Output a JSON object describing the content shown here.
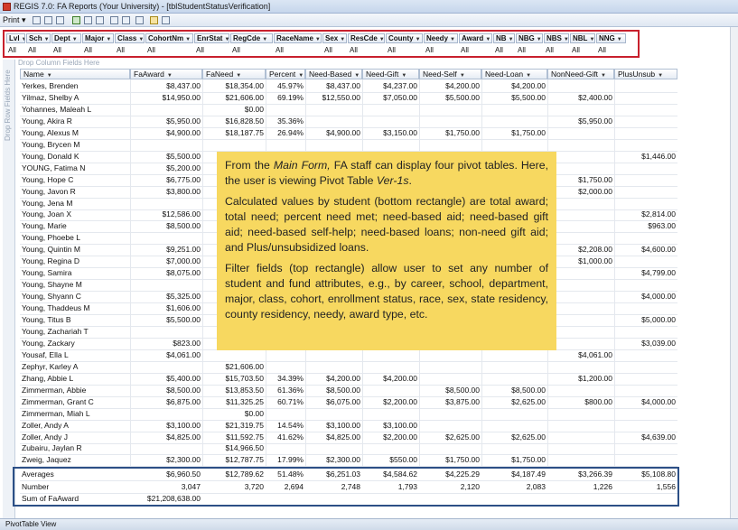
{
  "window": {
    "title": "REGIS 7.0: FA Reports (Your University) - [tblStudentStatusVerification]"
  },
  "toolbar": {
    "print_label": "Print"
  },
  "filters": [
    {
      "label": "Lvl",
      "value": "All"
    },
    {
      "label": "Sch",
      "value": "All"
    },
    {
      "label": "Dept",
      "value": "All"
    },
    {
      "label": "Major",
      "value": "All"
    },
    {
      "label": "Class",
      "value": "All"
    },
    {
      "label": "CohortNm",
      "value": "All"
    },
    {
      "label": "EnrStat",
      "value": "All"
    },
    {
      "label": "RegCde",
      "value": "All"
    },
    {
      "label": "RaceName",
      "value": "All"
    },
    {
      "label": "Sex",
      "value": "All"
    },
    {
      "label": "ResCde",
      "value": "All"
    },
    {
      "label": "County",
      "value": "All"
    },
    {
      "label": "Needy",
      "value": "All"
    },
    {
      "label": "Award",
      "value": "All"
    },
    {
      "label": "NB",
      "value": "All"
    },
    {
      "label": "NBG",
      "value": "All"
    },
    {
      "label": "NBS",
      "value": "All"
    },
    {
      "label": "NBL",
      "value": "All"
    },
    {
      "label": "NNG",
      "value": "All"
    }
  ],
  "drop_column_text": "Drop Column Fields Here",
  "drop_row_text": "Drop Row Fields Here",
  "columns": [
    "Name",
    "FaAward",
    "FaNeed",
    "Percent",
    "Need-Based",
    "Need-Gift",
    "Need-Self",
    "Need-Loan",
    "NonNeed-Gift",
    "PlusUnsub"
  ],
  "rows": [
    [
      "Yerkes, Brenden",
      "$8,437.00",
      "$18,354.00",
      "45.97%",
      "$8,437.00",
      "$4,237.00",
      "$4,200.00",
      "$4,200.00",
      "",
      ""
    ],
    [
      "Yilmaz, Shelby A",
      "$14,950.00",
      "$21,606.00",
      "69.19%",
      "$12,550.00",
      "$7,050.00",
      "$5,500.00",
      "$5,500.00",
      "$2,400.00",
      ""
    ],
    [
      "Yohannes, Maleah L",
      "",
      "$0.00",
      "",
      "",
      "",
      "",
      "",
      "",
      ""
    ],
    [
      "Young, Akira R",
      "$5,950.00",
      "$16,828.50",
      "35.36%",
      "",
      "",
      "",
      "",
      "$5,950.00",
      ""
    ],
    [
      "Young, Alexus M",
      "$4,900.00",
      "$18,187.75",
      "26.94%",
      "$4,900.00",
      "$3,150.00",
      "$1,750.00",
      "$1,750.00",
      "",
      ""
    ],
    [
      "Young, Brycen M",
      "",
      "",
      "",
      "",
      "",
      "",
      "",
      "",
      ""
    ],
    [
      "Young, Donald K",
      "$5,500.00",
      "",
      "",
      "",
      "",
      "",
      "",
      "",
      "$1,446.00"
    ],
    [
      "YOUNG, Fatima N",
      "$5,200.00",
      "",
      "",
      "",
      "",
      "",
      "",
      "",
      ""
    ],
    [
      "Young, Hope C",
      "$6,775.00",
      "",
      "",
      "",
      "",
      "",
      "",
      "$1,750.00",
      ""
    ],
    [
      "Young, Javon R",
      "$3,800.00",
      "",
      "",
      "",
      "",
      "",
      "",
      "$2,000.00",
      ""
    ],
    [
      "Young, Jena M",
      "",
      "",
      "",
      "",
      "",
      "",
      "",
      "",
      ""
    ],
    [
      "Young, Joan X",
      "$12,586.00",
      "",
      "",
      "",
      "",
      "",
      "",
      "",
      "$2,814.00"
    ],
    [
      "Young, Marie",
      "$8,500.00",
      "",
      "",
      "",
      "",
      "",
      "",
      "",
      "$963.00"
    ],
    [
      "Young, Phoebe L",
      "",
      "",
      "",
      "",
      "",
      "",
      "",
      "",
      ""
    ],
    [
      "Young, Quintin M",
      "$9,251.00",
      "",
      "",
      "",
      "",
      "",
      "",
      "$2,208.00",
      "$4,600.00"
    ],
    [
      "Young, Regina D",
      "$7,000.00",
      "",
      "",
      "",
      "",
      "",
      "",
      "$1,000.00",
      ""
    ],
    [
      "Young, Samira",
      "$8,075.00",
      "",
      "",
      "",
      "",
      "",
      "",
      "",
      "$4,799.00"
    ],
    [
      "Young, Shayne M",
      "",
      "",
      "",
      "",
      "",
      "",
      "",
      "",
      ""
    ],
    [
      "Young, Shyann C",
      "$5,325.00",
      "",
      "",
      "",
      "",
      "",
      "",
      "",
      "$4,000.00"
    ],
    [
      "Young, Thaddeus M",
      "$1,606.00",
      "",
      "",
      "",
      "",
      "",
      "",
      "",
      ""
    ],
    [
      "Young, Titus B",
      "$5,500.00",
      "",
      "",
      "",
      "",
      "",
      "",
      "",
      "$5,000.00"
    ],
    [
      "Young, Zachariah T",
      "",
      "",
      "",
      "",
      "",
      "",
      "",
      "",
      ""
    ],
    [
      "Young, Zackary",
      "$823.00",
      "",
      "",
      "",
      "",
      "",
      "",
      "",
      "$3,039.00"
    ],
    [
      "Yousaf, Ella L",
      "$4,061.00",
      "",
      "",
      "",
      "",
      "",
      "",
      "$4,061.00",
      ""
    ],
    [
      "Zephyr, Karley A",
      "",
      "$21,606.00",
      "",
      "",
      "",
      "",
      "",
      "",
      ""
    ],
    [
      "Zhang, Abbie L",
      "$5,400.00",
      "$15,703.50",
      "34.39%",
      "$4,200.00",
      "$4,200.00",
      "",
      "",
      "$1,200.00",
      ""
    ],
    [
      "Zimmerman, Abbie",
      "$8,500.00",
      "$13,853.50",
      "61.36%",
      "$8,500.00",
      "",
      "$8,500.00",
      "$8,500.00",
      "",
      ""
    ],
    [
      "Zimmerman, Grant C",
      "$6,875.00",
      "$11,325.25",
      "60.71%",
      "$6,075.00",
      "$2,200.00",
      "$3,875.00",
      "$2,625.00",
      "$800.00",
      "$4,000.00"
    ],
    [
      "Zimmerman, Miah L",
      "",
      "$0.00",
      "",
      "",
      "",
      "",
      "",
      "",
      ""
    ],
    [
      "Zoller, Andy A",
      "$3,100.00",
      "$21,319.75",
      "14.54%",
      "$3,100.00",
      "$3,100.00",
      "",
      "",
      "",
      ""
    ],
    [
      "Zoller, Andy J",
      "$4,825.00",
      "$11,592.75",
      "41.62%",
      "$4,825.00",
      "$2,200.00",
      "$2,625.00",
      "$2,625.00",
      "",
      "$4,639.00"
    ],
    [
      "Zubairu, Jaylan R",
      "",
      "$14,966.50",
      "",
      "",
      "",
      "",
      "",
      "",
      ""
    ],
    [
      "Zweig, Jaquez",
      "$2,300.00",
      "$12,787.75",
      "17.99%",
      "$2,300.00",
      "$550.00",
      "$1,750.00",
      "$1,750.00",
      "",
      ""
    ]
  ],
  "totals": [
    [
      "Averages",
      "$6,960.50",
      "$12,789.62",
      "51.48%",
      "$6,251.03",
      "$4,584.62",
      "$4,225.29",
      "$4,187.49",
      "$3,266.39",
      "$5,108.80"
    ],
    [
      "Number",
      "3,047",
      "3,720",
      "2,694",
      "2,748",
      "1,793",
      "2,120",
      "2,083",
      "1,226",
      "1,556"
    ],
    [
      "Sum of FaAward",
      "$21,208,638.00",
      "",
      "",
      "",
      "",
      "",
      "",
      "",
      ""
    ]
  ],
  "callout": {
    "p1_a": "From the ",
    "p1_em1": "Main Form,",
    "p1_b": " FA staff can display four pivot tables. Here, the user is viewing Pivot Table ",
    "p1_em2": "Ver-1s",
    "p1_c": ".",
    "p2": "Calculated values by student (bottom rectangle) are total award; total need; percent need met; need-based aid; need-based gift aid; need-based self-help; need-based loans; non-need gift aid; and Plus/unsubsidized loans.",
    "p3": "Filter fields (top rectangle) allow user to set any number of student and fund attributes, e.g., by career, school, department, major, class, cohort, enrollment status, race, sex, state residency, county residency, needy, award type, etc."
  },
  "status": {
    "label": "PivotTable View"
  }
}
